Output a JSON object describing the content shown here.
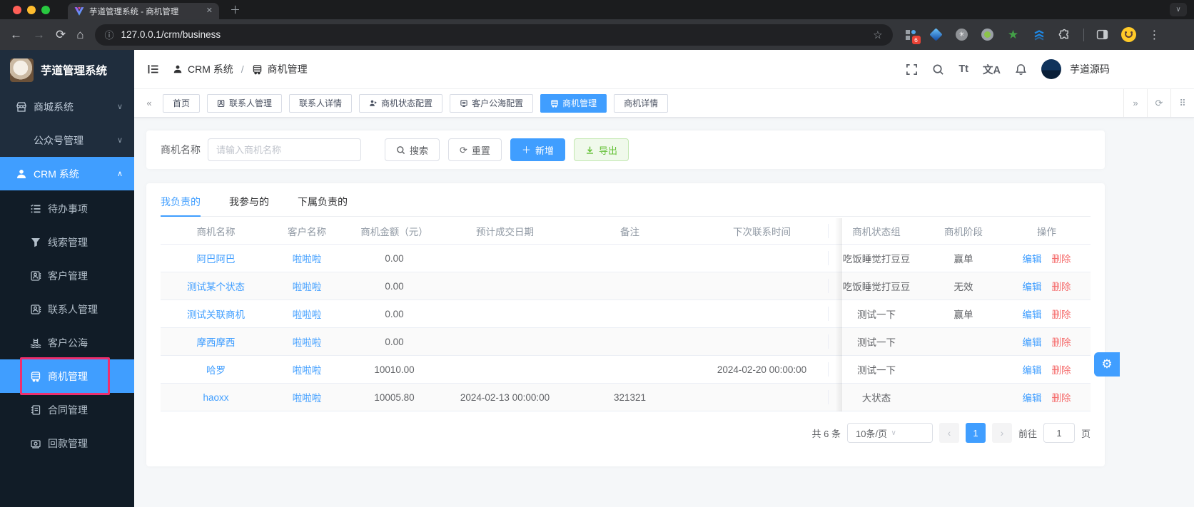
{
  "colors": {
    "accent": "#409eff",
    "danger": "#f56c6c",
    "success": "#67c23a",
    "annotation": "#ed2f6e",
    "sidebar_bg": "#1f2d3d"
  },
  "browser": {
    "tab_title": "芋道管理系统 - 商机管理",
    "url": "127.0.0.1/crm/business",
    "extension_badge": "6",
    "extension_icons": [
      "grid-extension-icon",
      "gem-extension-icon",
      "circle-asterisk-extension-icon",
      "circle-dot-extension-icon",
      "star-extension-icon",
      "layers-extension-icon",
      "puzzle-extensions-icon",
      "side-panel-icon",
      "profile-smiley-icon",
      "overflow-menu-icon"
    ]
  },
  "icons": {
    "back": "←",
    "forward": "→",
    "reload": "⟳",
    "home": "⌂",
    "info": "ⓘ",
    "star": "☆",
    "overflow": "⋮",
    "tab_close": "✕",
    "new_tab": "＋",
    "chevron_down": "∨",
    "chevron_up": "∧",
    "font_size": "Tt",
    "translate": "文A",
    "collapse": "«",
    "expand": "»",
    "refresh": "⟳",
    "grid": "⠿",
    "slash": "/",
    "gear": "⚙",
    "prev": "‹",
    "next": "›",
    "asterisk": "✳",
    "ext_star": "★"
  },
  "sidebar": {
    "logo_title": "芋道管理系统",
    "top_items": [
      {
        "label": "商城系统",
        "icon": "shop-icon"
      },
      {
        "label": "公众号管理",
        "icon": null
      },
      {
        "label": "CRM 系统",
        "icon": "user-icon"
      }
    ],
    "crm_children": [
      {
        "label": "待办事项",
        "icon": "todo-list-icon"
      },
      {
        "label": "线索管理",
        "icon": "clue-funnel-icon"
      },
      {
        "label": "客户管理",
        "icon": "customer-card-icon"
      },
      {
        "label": "联系人管理",
        "icon": "contact-card-icon"
      },
      {
        "label": "客户公海",
        "icon": "pool-icon"
      },
      {
        "label": "商机管理",
        "icon": "bus-icon"
      },
      {
        "label": "合同管理",
        "icon": "contract-icon"
      },
      {
        "label": "回款管理",
        "icon": "payment-icon"
      }
    ]
  },
  "header": {
    "breadcrumb_1": "CRM 系统",
    "breadcrumb_2": "商机管理",
    "username": "芋道源码"
  },
  "tagbar": {
    "tabs": [
      {
        "label": "首页"
      },
      {
        "label": "联系人管理"
      },
      {
        "label": "联系人详情"
      },
      {
        "label": "商机状态配置"
      },
      {
        "label": "客户公海配置"
      },
      {
        "label": "商机管理"
      },
      {
        "label": "商机详情"
      }
    ]
  },
  "search": {
    "label": "商机名称",
    "placeholder": "请输入商机名称",
    "search_btn": "搜索",
    "reset_btn": "重置",
    "add_btn": "新增",
    "export_btn": "导出"
  },
  "list_tabs": {
    "t0": "我负责的",
    "t1": "我参与的",
    "t2": "下属负责的"
  },
  "table": {
    "headers": [
      "商机名称",
      "客户名称",
      "商机金额（元）",
      "预计成交日期",
      "备注",
      "下次联系时间",
      "商机状态组",
      "商机阶段",
      "操作"
    ],
    "edit_label": "编辑",
    "delete_label": "删除",
    "rows": [
      {
        "name": "阿巴阿巴",
        "customer": "啦啦啦",
        "amount": "0.00",
        "deal_date": "",
        "remark": "",
        "next_time": "",
        "status_group": "吃饭睡觉打豆豆",
        "stage": "赢单"
      },
      {
        "name": "测试某个状态",
        "customer": "啦啦啦",
        "amount": "0.00",
        "deal_date": "",
        "remark": "",
        "next_time": "",
        "status_group": "吃饭睡觉打豆豆",
        "stage": "无效"
      },
      {
        "name": "测试关联商机",
        "customer": "啦啦啦",
        "amount": "0.00",
        "deal_date": "",
        "remark": "",
        "next_time": "",
        "status_group": "测试一下",
        "stage": "赢单"
      },
      {
        "name": "摩西摩西",
        "customer": "啦啦啦",
        "amount": "0.00",
        "deal_date": "",
        "remark": "",
        "next_time": "",
        "status_group": "测试一下",
        "stage": ""
      },
      {
        "name": "哈罗",
        "customer": "啦啦啦",
        "amount": "10010.00",
        "deal_date": "",
        "remark": "",
        "next_time": "2024-02-20 00:00:00",
        "status_group": "测试一下",
        "stage": ""
      },
      {
        "name": "haoxx",
        "customer": "啦啦啦",
        "amount": "10005.80",
        "deal_date": "2024-02-13 00:00:00",
        "remark": "321321",
        "next_time": "",
        "status_group": "大状态",
        "stage": ""
      }
    ]
  },
  "pagination": {
    "total": "共 6 条",
    "page_size": "10条/页",
    "current_page": "1",
    "goto_label": "前往",
    "goto_value": "1",
    "page_label": "页"
  }
}
